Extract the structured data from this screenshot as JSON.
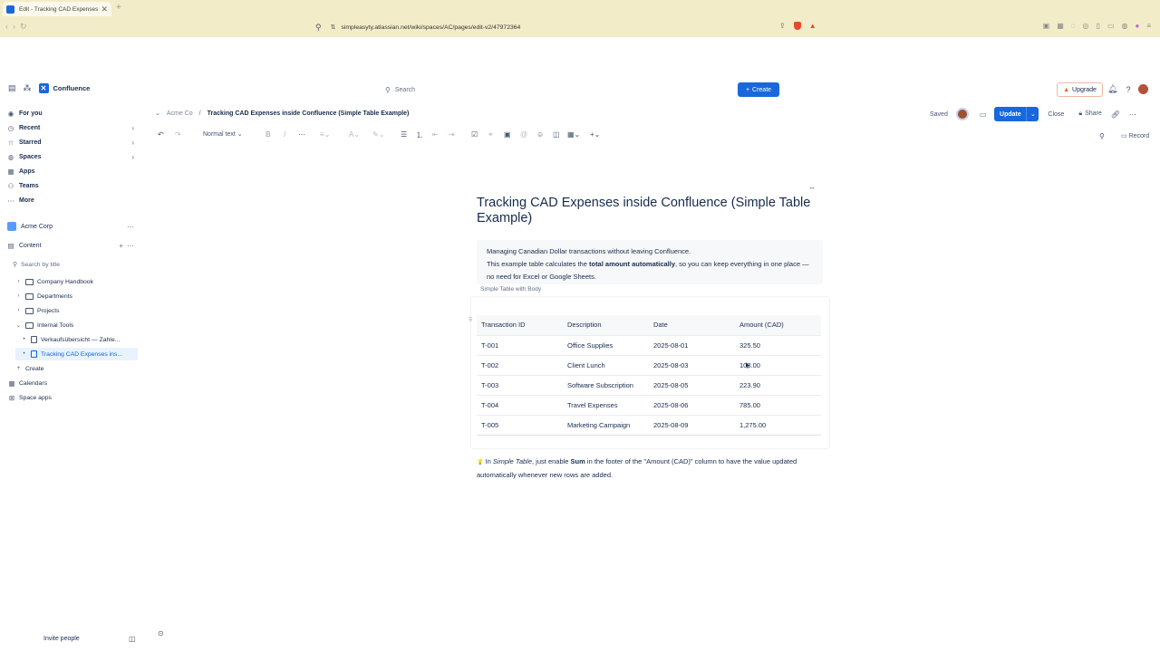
{
  "browser": {
    "tab_title": "Edit - Tracking CAD Expenses",
    "tab_close": "✕",
    "new_tab": "+",
    "url": "simpleasyty.atlassian.net/wiki/spaces/AC/pages/edit-v2/47972364"
  },
  "topnav": {
    "product": "Confluence",
    "search_placeholder": "Search",
    "create_label": "Create",
    "upgrade_label": "Upgrade"
  },
  "sidebar": {
    "nav": [
      {
        "label": "For you",
        "icon": "home-icon"
      },
      {
        "label": "Recent",
        "icon": "clock-icon"
      },
      {
        "label": "Starred",
        "icon": "star-icon"
      },
      {
        "label": "Spaces",
        "icon": "globe-icon"
      },
      {
        "label": "Apps",
        "icon": "apps-icon"
      },
      {
        "label": "Teams",
        "icon": "teams-icon"
      },
      {
        "label": "More",
        "icon": "more-icon"
      }
    ],
    "space_name": "Acme Corp",
    "content_label": "Content",
    "search_placeholder": "Search by title",
    "tree": [
      {
        "label": "Company Handbook"
      },
      {
        "label": "Departments"
      },
      {
        "label": "Projects"
      },
      {
        "label": "Internal Tools"
      },
      {
        "label": "Verkaufsübersicht — Zahle..."
      },
      {
        "label": "Tracking CAD Expenses ins..."
      }
    ],
    "create_label": "Create",
    "calendars_label": "Calendars",
    "space_apps_label": "Space apps",
    "invite_label": "Invite people"
  },
  "header": {
    "breadcrumb_space": "Acme Co",
    "breadcrumb_sep": "/",
    "breadcrumb_page": "Tracking CAD Expenses inside Confluence (Simple Table Example)",
    "saved_label": "Saved",
    "update_label": "Update",
    "close_label": "Close",
    "share_label": "Share"
  },
  "toolbar": {
    "text_style": "Normal text",
    "record_label": "Record"
  },
  "page": {
    "title": "Tracking CAD Expenses inside Confluence (Simple Table Example)",
    "panel_line1": "Managing Canadian Dollar transactions without leaving Confluence.",
    "panel_line2_pre": "This example table calculates the ",
    "panel_line2_bold": "total amount automatically",
    "panel_line2_post": ", so you can keep everything in one place — no need for Excel or Google Sheets.",
    "macro_label": "Simple Table with Body",
    "table_headers": [
      "Transaction ID",
      "Description",
      "Date",
      "Amount (CAD)"
    ],
    "table_rows": [
      [
        "T-001",
        "Office Supplies",
        "2025-08-01",
        "325.50"
      ],
      [
        "T-002",
        "Client Lunch",
        "2025-08-03",
        "108.00"
      ],
      [
        "T-003",
        "Software Subscription",
        "2025-08-05",
        "223.90"
      ],
      [
        "T-004",
        "Travel Expenses",
        "2025-08-06",
        "785.00"
      ],
      [
        "T-005",
        "Marketing Campaign",
        "2025-08-09",
        "1,275.00"
      ]
    ],
    "note_icon": "💡",
    "note_pre": " In ",
    "note_italic": "Simple Table",
    "note_mid": ", just enable ",
    "note_bold": "Sum",
    "note_post": " in the footer of the \"Amount (CAD)\" column to have the value updated automatically whenever new rows are added."
  }
}
